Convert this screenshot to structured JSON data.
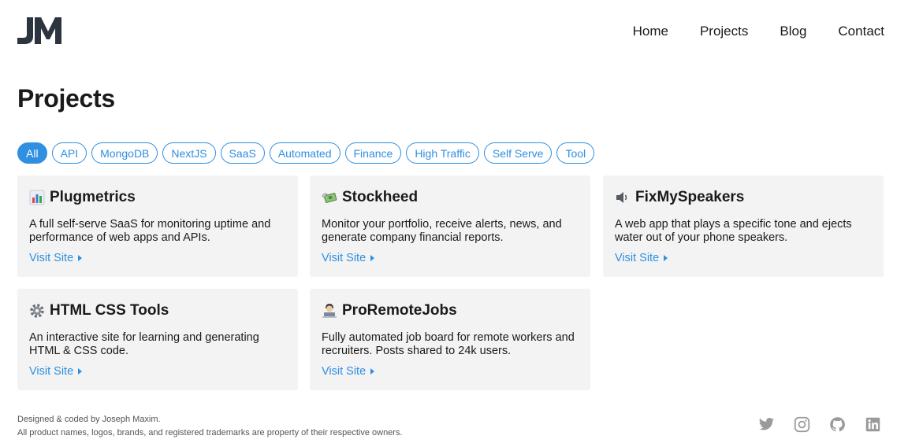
{
  "logo": {
    "text": "JM",
    "icon": "jm-logo"
  },
  "nav": {
    "items": [
      "Home",
      "Projects",
      "Blog",
      "Contact"
    ]
  },
  "page": {
    "title": "Projects"
  },
  "filters": {
    "items": [
      "All",
      "API",
      "MongoDB",
      "NextJS",
      "SaaS",
      "Automated",
      "Finance",
      "High Traffic",
      "Self Serve",
      "Tool"
    ],
    "active": "All"
  },
  "projects": [
    {
      "icon": "bar-chart-icon",
      "title": "Plugmetrics",
      "description": "A full self-serve SaaS for monitoring uptime and performance of web apps and APIs.",
      "link": "Visit Site"
    },
    {
      "icon": "money-wings-icon",
      "title": "Stockheed",
      "description": "Monitor your portfolio, receive alerts, news, and generate company financial reports.",
      "link": "Visit Site"
    },
    {
      "icon": "speaker-icon",
      "title": "FixMySpeakers",
      "description": "A web app that plays a specific tone and ejects water out of your phone speakers.",
      "link": "Visit Site"
    },
    {
      "icon": "gear-icon",
      "title": "HTML CSS Tools",
      "description": "An interactive site for learning and generating HTML & CSS code.",
      "link": "Visit Site"
    },
    {
      "icon": "technologist-icon",
      "title": "ProRemoteJobs",
      "description": "Fully automated job board for remote workers and recruiters. Posts shared to 24k users.",
      "link": "Visit Site"
    }
  ],
  "footer": {
    "credit": "Designed & coded by Joseph Maxim.",
    "disclaimer": "All product names, logos, brands, and registered trademarks are property of their respective owners.",
    "social": [
      "twitter-icon",
      "instagram-icon",
      "github-icon",
      "linkedin-icon"
    ]
  },
  "colors": {
    "accent": "#2f8fe0",
    "card_bg": "#f3f3f3",
    "logo": "#2c3440",
    "social": "#9a9a9a"
  }
}
